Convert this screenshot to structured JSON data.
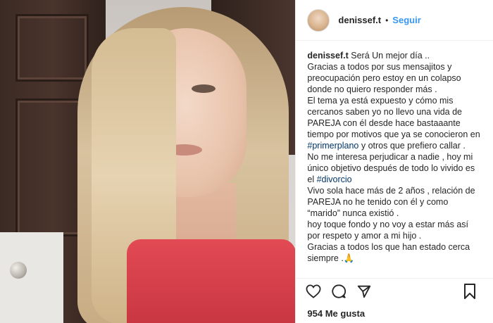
{
  "header": {
    "username": "denissef.t",
    "dot": "•",
    "follow_label": "Seguir"
  },
  "caption": {
    "username": "denissef.t",
    "segments": [
      {
        "text": " Será Un mejor día ..\nGracias a todos por sus mensajitos y preocupación pero estoy en un colapso donde no quiero responder más .\nEl tema ya está expuesto y cómo mis cercanos saben yo no llevo una vida de PAREJA con él desde hace bastaaante tiempo por motivos que ya se conocieron en "
      },
      {
        "text": "#primerplano",
        "tag": true
      },
      {
        "text": " y otros que prefiero callar .\nNo me interesa perjudicar a nadie , hoy mi único objetivo después de todo lo vivido es el "
      },
      {
        "text": "#divorcio",
        "tag": true
      },
      {
        "text": "\nVivo sola hace más de 2 años , relación de PAREJA no he tenido con él y como “marido” nunca existió .\nhoy toque fondo y no voy a estar más así por respeto y amor a mi hijo .\nGracias a todos los que han estado cerca siempre .🙏"
      }
    ]
  },
  "likes": "954 Me gusta",
  "icons": [
    "heart-icon",
    "comment-icon",
    "share-icon",
    "bookmark-icon"
  ],
  "colors": {
    "link": "#3897f0",
    "hashtag": "#003569",
    "text": "#262626"
  }
}
